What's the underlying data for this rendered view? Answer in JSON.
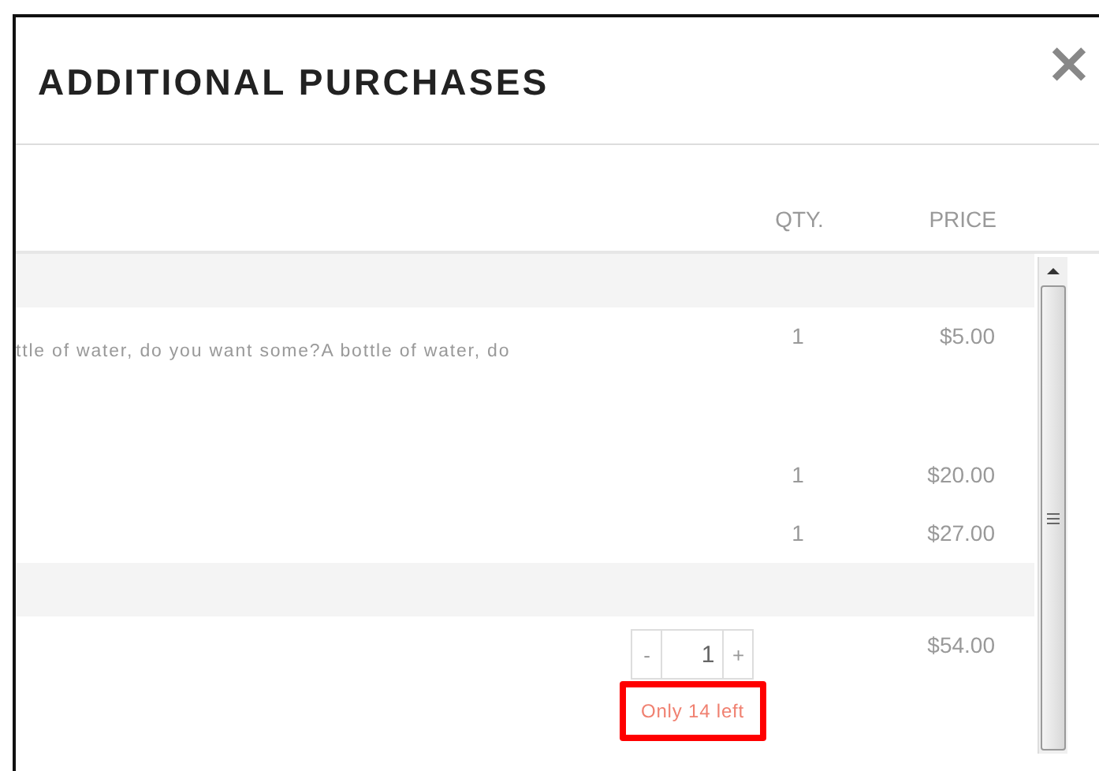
{
  "dialog": {
    "title": "ADDITIONAL PURCHASES",
    "close": "×"
  },
  "columns": [
    {
      "label": "QTY."
    },
    {
      "label": "PRICE"
    }
  ],
  "rows": [
    {
      "kind": "group"
    },
    {
      "kind": "item",
      "qty": "1",
      "price": "$5.00",
      "description": "ttle of water, do you want some?A bottle of water, do"
    },
    {
      "kind": "item",
      "qty": "1",
      "price": "$20.00"
    },
    {
      "kind": "item",
      "qty": "1",
      "price": "$27.00"
    },
    {
      "kind": "group"
    },
    {
      "kind": "stepper",
      "minus": "-",
      "value": "1",
      "plus": "+",
      "price": "$54.00",
      "stock": "Only 14 left",
      "highlighted": true
    }
  ]
}
